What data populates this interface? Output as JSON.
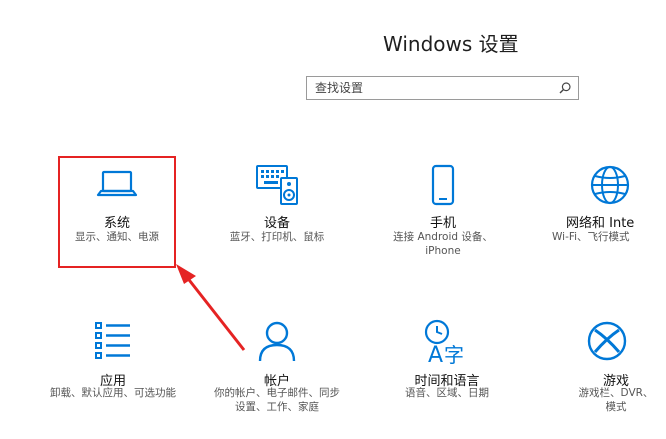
{
  "header": {
    "title": "Windows 设置"
  },
  "search": {
    "placeholder": "查找设置"
  },
  "tiles": [
    {
      "name": "系统",
      "desc1": "显示、通知、电源",
      "desc2": ""
    },
    {
      "name": "设备",
      "desc1": "蓝牙、打印机、鼠标",
      "desc2": ""
    },
    {
      "name": "手机",
      "desc1": "连接 Android 设备、",
      "desc2": "iPhone"
    },
    {
      "name": "网络和 Inte",
      "desc1": "Wi-Fi、飞行模式",
      "desc2": ""
    },
    {
      "name": "应用",
      "desc1": "卸载、默认应用、可选功能",
      "desc2": ""
    },
    {
      "name": "帐户",
      "desc1": "你的帐户、电子邮件、同步",
      "desc2": "设置、工作、家庭"
    },
    {
      "name": "时间和语言",
      "desc1": "语音、区域、日期",
      "desc2": ""
    },
    {
      "name": "游戏",
      "desc1": "游戏栏、DVR、",
      "desc2": "模式"
    }
  ],
  "colors": {
    "accent": "#0078d7",
    "highlight": "#e52323"
  }
}
